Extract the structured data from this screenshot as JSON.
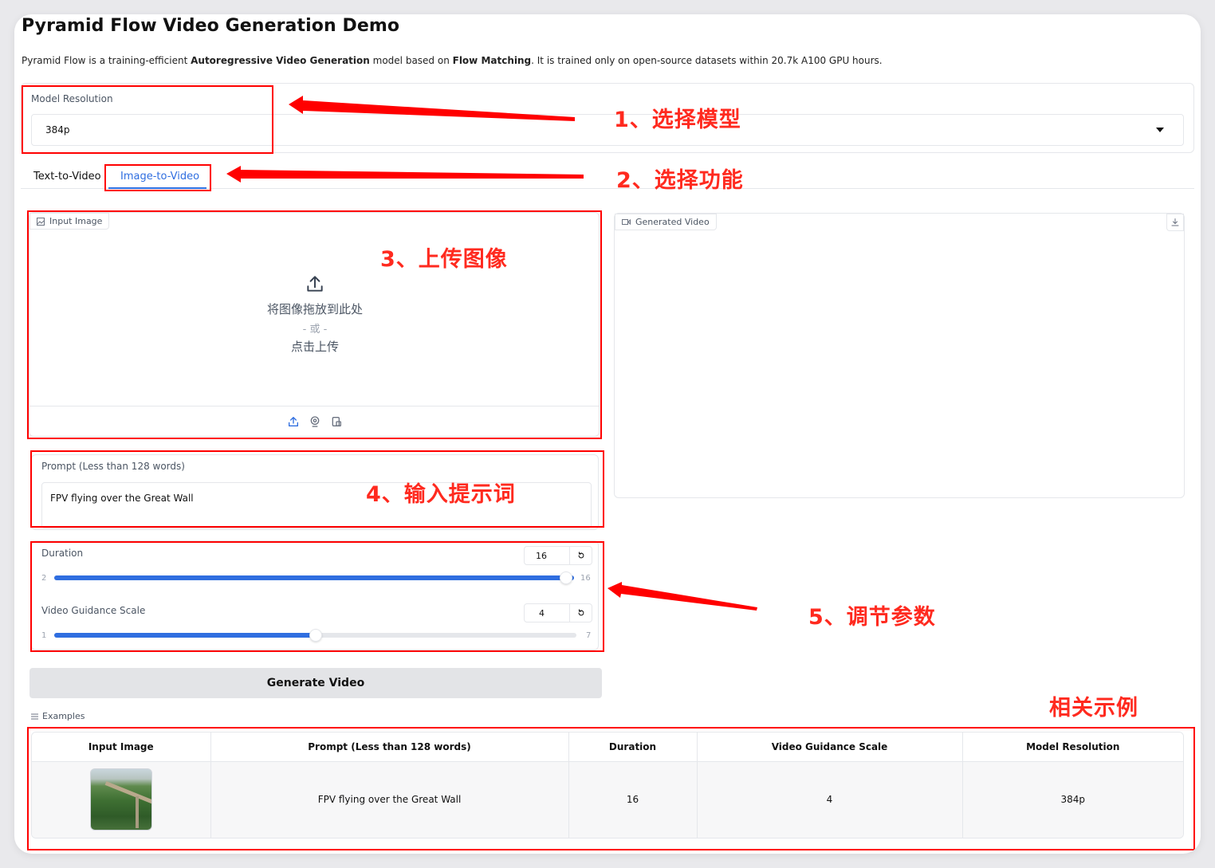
{
  "title": "Pyramid Flow Video Generation Demo",
  "description": {
    "p1": "Pyramid Flow is a training-efficient ",
    "b1": "Autoregressive Video Generation",
    "p2": " model based on ",
    "b2": "Flow Matching",
    "p3": ". It is trained only on open-source datasets within 20.7k A100 GPU hours."
  },
  "model_resolution": {
    "label": "Model Resolution",
    "value": "384p"
  },
  "tabs": [
    "Text-to-Video",
    "Image-to-Video"
  ],
  "input_image": {
    "label": "Input Image",
    "drop_text": "将图像拖放到此处",
    "or_text": "- 或 -",
    "click_text": "点击上传"
  },
  "generated_video": {
    "label": "Generated Video"
  },
  "prompt": {
    "label": "Prompt (Less than 128 words)",
    "value": "FPV flying over the Great Wall"
  },
  "duration": {
    "label": "Duration",
    "value": "16",
    "min": "2",
    "max": "16",
    "fraction": 1.0
  },
  "guidance": {
    "label": "Video Guidance Scale",
    "value": "4",
    "min": "1",
    "max": "7",
    "fraction": 0.5
  },
  "generate_button": "Generate Video",
  "examples": {
    "label": "Examples",
    "headers": [
      "Input Image",
      "Prompt (Less than 128 words)",
      "Duration",
      "Video Guidance Scale",
      "Model Resolution"
    ],
    "row": [
      "FPV flying over the Great Wall",
      "16",
      "4",
      "384p"
    ]
  },
  "annotations": {
    "a1": "1、选择模型",
    "a2": "2、选择功能",
    "a3": "3、上传图像",
    "a4": "4、输入提示词",
    "a5": "5、调节参数",
    "a6": "相关示例"
  },
  "colors": {
    "accent": "#2f6ee0",
    "annotation": "#ff0000"
  }
}
